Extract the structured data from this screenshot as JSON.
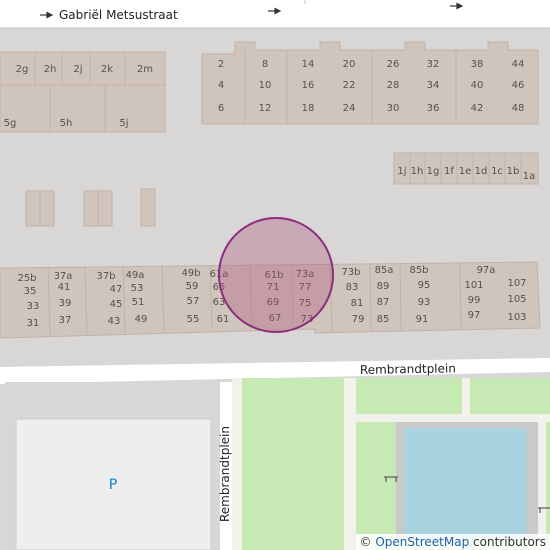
{
  "streets": {
    "north": "Gabriël Metsustraat",
    "south": "Rembrandtplein",
    "west_vertical": "Rembrandtplein"
  },
  "parking": {
    "label": "P"
  },
  "attribution": {
    "prefix": "© ",
    "link": "OpenStreetMap",
    "suffix": " contributors"
  },
  "housenumbers": {
    "row_top_left": [
      "2g",
      "2h",
      "2j",
      "2k",
      "2m",
      "5g",
      "5h",
      "5j"
    ],
    "row_top_right": [
      "2",
      "8",
      "14",
      "20",
      "26",
      "32",
      "38",
      "44",
      "4",
      "10",
      "16",
      "22",
      "28",
      "34",
      "40",
      "46",
      "6",
      "12",
      "18",
      "24",
      "30",
      "36",
      "42",
      "48"
    ],
    "row_middle": [
      "1j",
      "1h",
      "1g",
      "1f",
      "1e",
      "1d",
      "1c",
      "1b",
      "1a"
    ],
    "row_bottom": [
      "25b",
      "37a",
      "37b",
      "49a",
      "49b",
      "61a",
      "61b",
      "73a",
      "73b",
      "85a",
      "85b",
      "97a",
      "35",
      "41",
      "47",
      "53",
      "59",
      "65",
      "71",
      "77",
      "83",
      "89",
      "95",
      "101",
      "107",
      "33",
      "39",
      "45",
      "51",
      "57",
      "63",
      "69",
      "75",
      "81",
      "87",
      "93",
      "99",
      "105",
      "31",
      "37",
      "43",
      "49",
      "55",
      "61",
      "67",
      "73",
      "79",
      "85",
      "91",
      "97",
      "103"
    ]
  },
  "colors": {
    "background": "#d9d7d6",
    "building": "#d0c5bd",
    "building_stroke": "#bfb2a9",
    "park": "#c7e9b4",
    "water": "#a9d3de",
    "path": "#f3f1ec",
    "parking": "#eeeeee",
    "marker_fill": "#b0547e",
    "marker_stroke": "#8a2d7e",
    "parking_label": "#0b84c6"
  },
  "marker": {
    "type": "location-circle",
    "opacity": 0.35
  }
}
